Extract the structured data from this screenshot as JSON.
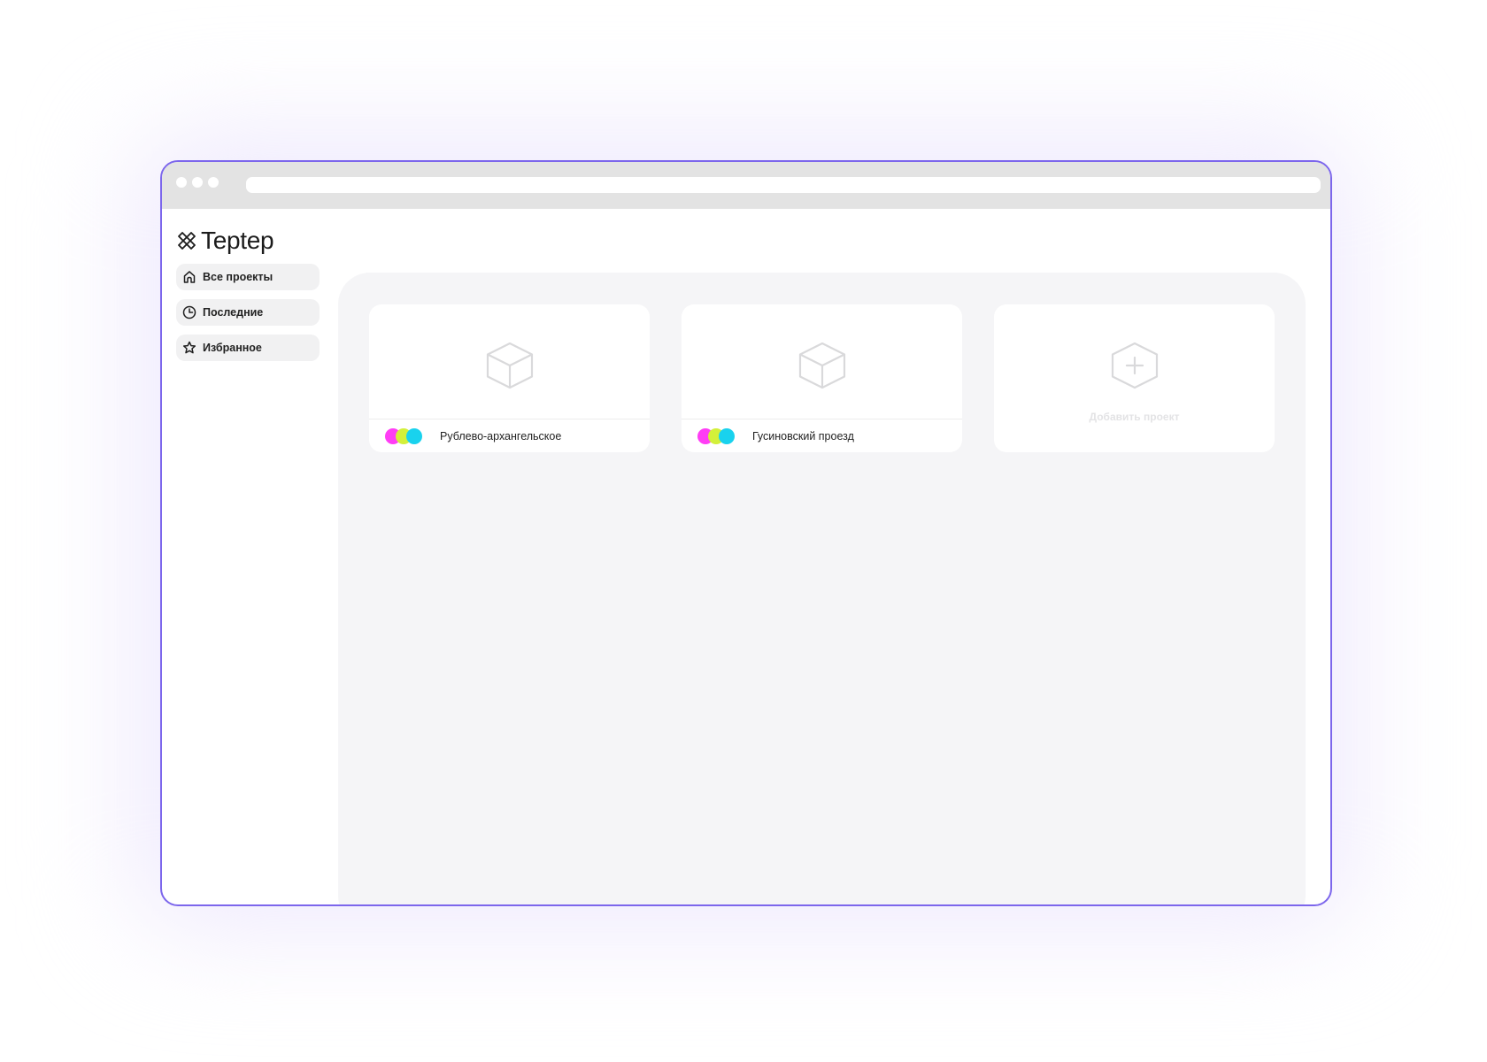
{
  "app": {
    "name": "Teptep",
    "logo_icon": "cross-scissors-logo"
  },
  "browser": {
    "controls": [
      "dot",
      "dot",
      "dot"
    ]
  },
  "sidebar": {
    "items": [
      {
        "label": "Все проекты",
        "icon": "home-icon"
      },
      {
        "label": "Последние",
        "icon": "clock-icon"
      },
      {
        "label": "Избранное",
        "icon": "star-icon"
      }
    ]
  },
  "projects": [
    {
      "name": "Рублево-архангельское",
      "icon": "cube-icon",
      "avatars": [
        "#ff3df5",
        "#d3f03a",
        "#19d2ee"
      ]
    },
    {
      "name": "Гусиновский проезд",
      "icon": "cube-icon",
      "avatars": [
        "#ff3df5",
        "#d3f03a",
        "#19d2ee"
      ]
    }
  ],
  "add_project": {
    "label": "Добавить проект",
    "icon": "hexagon-plus-icon"
  },
  "colors": {
    "window_border": "#7c66ec",
    "titlebar": "#e3e3e3",
    "panel_background": "#f5f5f7",
    "avatar_magenta": "#ff3df5",
    "avatar_lime": "#d3f03a",
    "avatar_cyan": "#19d2ee"
  }
}
